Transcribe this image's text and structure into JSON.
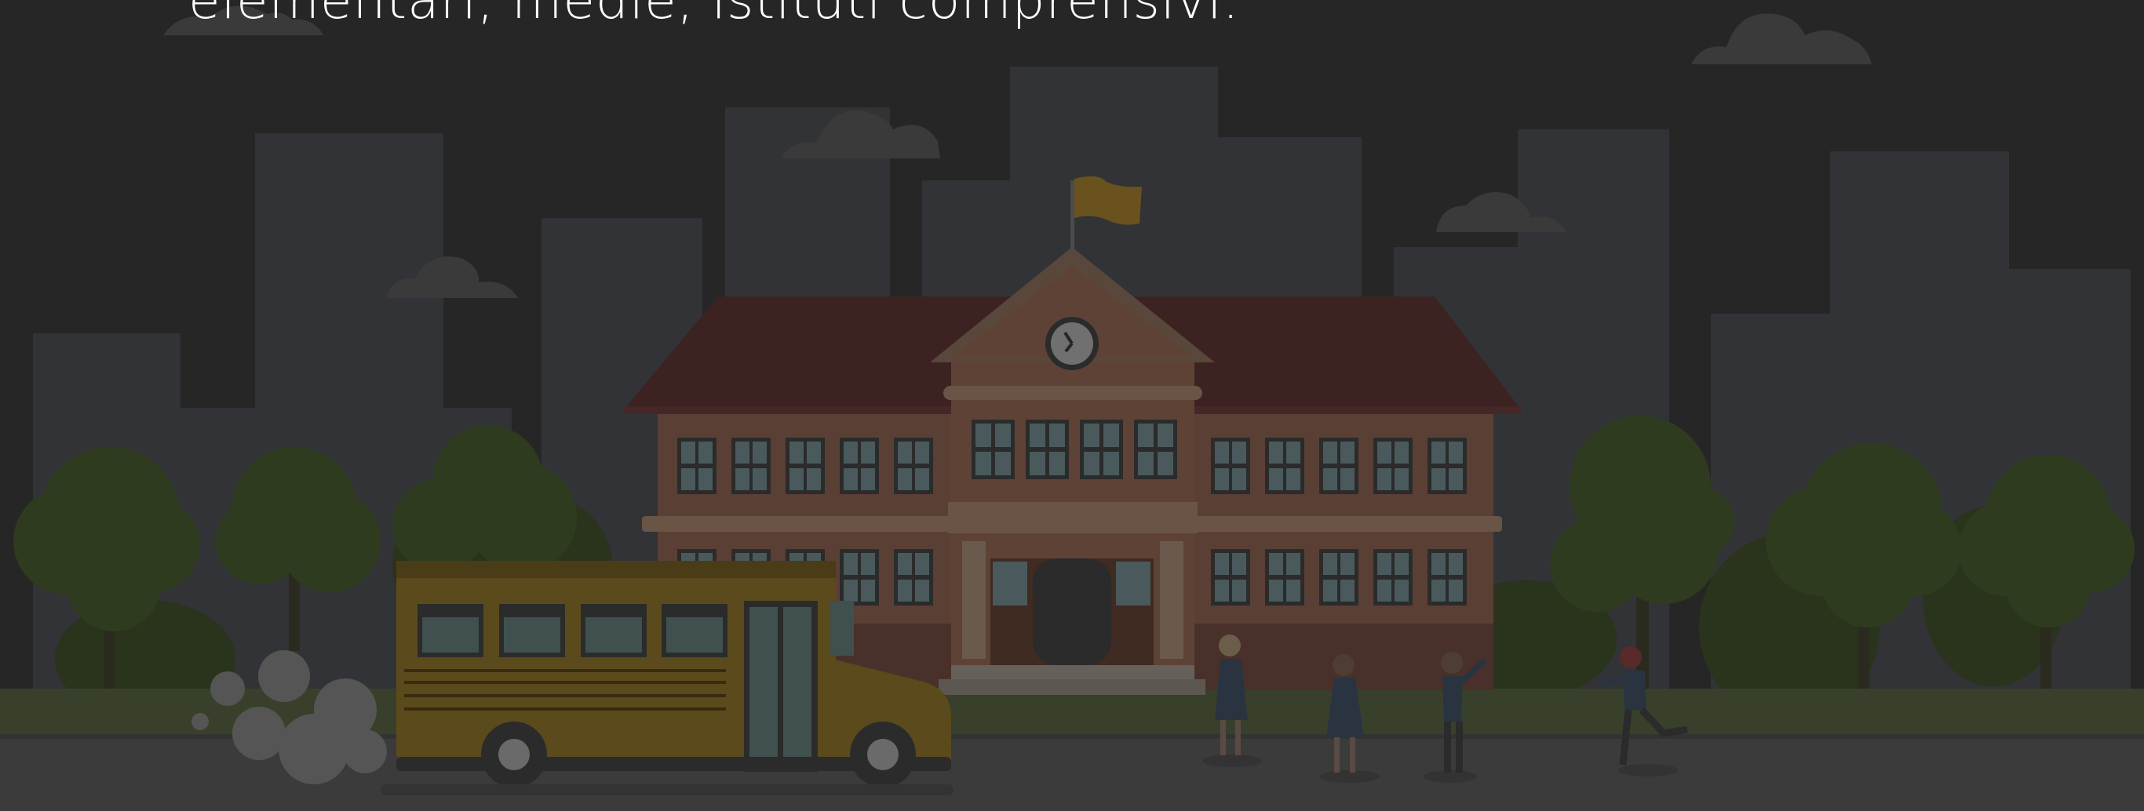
{
  "hero": {
    "headline": "elementari, medie, istituti comprensivi."
  },
  "colors": {
    "background": "#262626",
    "buildings": "#313336",
    "clouds": "#3a3a3a",
    "trees": "#2f3b1e",
    "ground": "#38402b",
    "road": "#3b3b3b",
    "school_wall": "#5a3f35",
    "roof": "#3d2222",
    "bus": "#5b4a1c",
    "flag": "#6a521e"
  },
  "scene": {
    "illustration": "school-building-with-bus-and-students"
  }
}
